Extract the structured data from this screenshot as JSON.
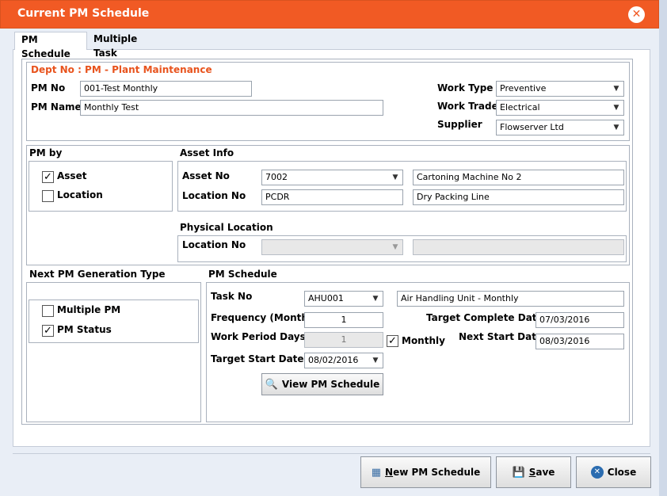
{
  "window": {
    "title": "Current PM Schedule"
  },
  "tabs": [
    {
      "label": "PM Schedule"
    },
    {
      "label": "Multiple Task"
    }
  ],
  "header": {
    "dept": "Dept No : PM - Plant Maintenance",
    "pm_no_label": "PM No",
    "pm_no_value": "001-Test Monthly",
    "pm_name_label": "PM Name",
    "pm_name_value": "Monthly Test",
    "work_type_label": "Work Type",
    "work_type_value": "Preventive",
    "work_trade_label": "Work Trade",
    "work_trade_value": "Electrical",
    "supplier_label": "Supplier",
    "supplier_value": "Flowserver Ltd"
  },
  "pm_by": {
    "title": "PM by",
    "asset_label": "Asset",
    "asset_checked": true,
    "location_label": "Location",
    "location_checked": false
  },
  "asset_info": {
    "title": "Asset Info",
    "asset_no_label": "Asset No",
    "asset_no_value": "7002",
    "asset_desc": "Cartoning Machine No 2",
    "location_no_label": "Location No",
    "location_no_value": "PCDR",
    "location_desc": "Dry Packing Line"
  },
  "physical_location": {
    "title": "Physical Location",
    "location_no_label": "Location No",
    "location_no_value": "",
    "location_desc": ""
  },
  "next_pm": {
    "title": "Next PM Generation Type",
    "multiple_label": "Multiple PM",
    "multiple_checked": false,
    "status_label": "PM Status",
    "status_checked": true
  },
  "pm_schedule": {
    "title": "PM Schedule",
    "task_no_label": "Task No",
    "task_no_value": "AHU001",
    "task_desc": "Air Handling Unit - Monthly",
    "frequency_label": "Frequency (Months)",
    "frequency_value": "1",
    "target_complete_label": "Target Complete Date",
    "target_complete_value": "07/03/2016",
    "work_period_label": "Work Period Days",
    "work_period_value": "1",
    "monthly_label": "Monthly",
    "monthly_checked": true,
    "next_start_label": "Next Start Date",
    "next_start_value": "08/03/2016",
    "target_start_label": "Target Start Date",
    "target_start_value": "08/02/2016",
    "view_button": "View PM Schedule"
  },
  "footer": {
    "new_first": "N",
    "new_rest": "ew PM Schedule",
    "save_first": "S",
    "save_rest": "ave",
    "close_label": "Close"
  },
  "icons": {
    "close": "close-icon",
    "check": "check-icon",
    "dropdown": "chevron-down-icon",
    "view": "search-icon",
    "new": "calendar-icon",
    "save": "save-icon",
    "close_button": "close-circle-icon"
  },
  "colors": {
    "titlebar": "#f15a24",
    "dept_text": "#e8531d",
    "close_icon": "#2b6cb0"
  }
}
